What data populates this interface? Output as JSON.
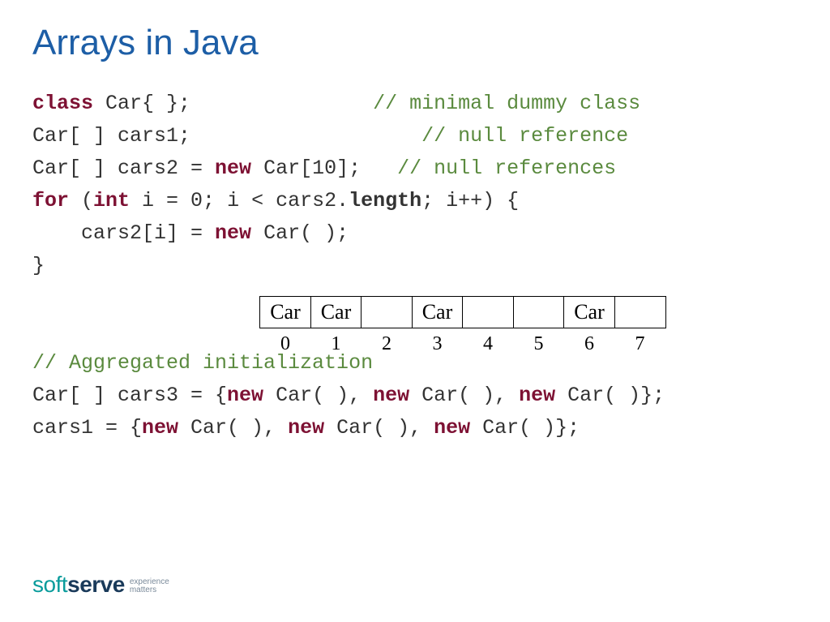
{
  "title": "Arrays in Java",
  "code": {
    "l1a": "class",
    "l1b": " Car{ };",
    "l1pad": "               ",
    "l1c": "// minimal dummy class",
    "l2a": "Car[ ] cars1;",
    "l2pad": "                   ",
    "l2c": "// null reference",
    "l3a": "Car[ ] cars2 = ",
    "l3b": "new",
    "l3c": " Car[10];",
    "l3pad": "   ",
    "l3d": "// null references",
    "l4a": "for",
    "l4b": " (",
    "l4c": "int",
    "l4d": " i = 0; i < cars2.",
    "l4e": "length",
    "l4f": "; i++) {",
    "l5a": "    cars2[i] = ",
    "l5b": "new",
    "l5c": " Car( );",
    "l6": "}",
    "l8": "// Aggregated initialization",
    "l9a": "Car[ ] cars3 = {",
    "l9b": "new",
    "l9c": " Car( ), ",
    "l9d": "new",
    "l9e": " Car( ), ",
    "l9f": "new",
    "l9g": " Car( )};",
    "l10a": "cars1 = {",
    "l10b": "new",
    "l10c": " Car( ), ",
    "l10d": "new",
    "l10e": " Car( ), ",
    "l10f": "new",
    "l10g": " Car( )};"
  },
  "array": {
    "cells": [
      "Car",
      "Car",
      "",
      "Car",
      "",
      "",
      "Car",
      ""
    ],
    "index": [
      "0",
      "1",
      "2",
      "3",
      "4",
      "5",
      "6",
      "7"
    ]
  },
  "logo": {
    "soft": "soft",
    "serve": "serve",
    "tag1": "experience",
    "tag2": "matters"
  }
}
